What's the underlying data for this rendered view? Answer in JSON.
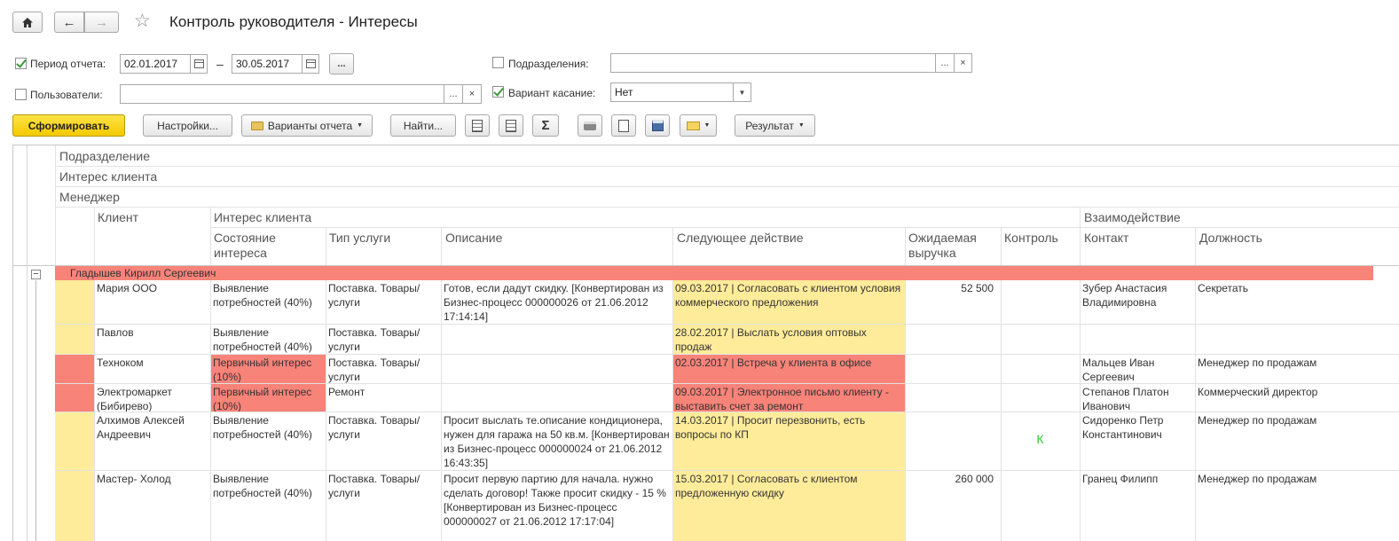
{
  "window": {
    "title": "Контроль руководителя - Интересы"
  },
  "filters": {
    "period_label": "Период отчета:",
    "period_from": "02.01.2017",
    "period_to": "30.05.2017",
    "dash": "–",
    "dots": "...",
    "subdiv_label": "Подразделения:",
    "users_label": "Пользователи:",
    "variant_label": "Вариант касание:",
    "variant_value": "Нет",
    "clear": "×"
  },
  "toolbar": {
    "generate": "Сформировать",
    "settings": "Настройки...",
    "variants": "Варианты отчета",
    "find": "Найти...",
    "sum": "Σ",
    "result": "Результат"
  },
  "report": {
    "group_headers": [
      "Подразделение",
      "Интерес клиента",
      "Менеджер"
    ],
    "col_client": "Клиент",
    "col_interest_group": "Интерес клиента",
    "col_state": "Состояние интереса",
    "col_type": "Тип услуги",
    "col_desc": "Описание",
    "col_next": "Следующее действие",
    "col_revenue": "Ожидаемая выручка",
    "col_control": "Контроль",
    "col_interact_group": "Взаимодействие",
    "col_contact": "Контакт",
    "col_position": "Должность",
    "manager_group": "Гладышев Кирилл Сергеевич",
    "collapse": "−",
    "rows": [
      {
        "client": "Мария ООО",
        "state": "Выявление потребностей (40%)",
        "type": "Поставка. Товары/услуги",
        "desc": "Готов, если дадут скидку. [Конвертирован из Бизнес-процесс 000000026 от 21.06.2012 17:14:14]",
        "next": "09.03.2017 | Согласовать с клиентом условия коммерческого предложения",
        "revenue": "52 500",
        "control": "",
        "contact": "Зубер Анастасия Владимировна",
        "position": "Секретать"
      },
      {
        "client": "Павлов",
        "state": "Выявление потребностей (40%)",
        "type": "Поставка. Товары/услуги",
        "desc": "",
        "next": "28.02.2017 | Выслать условия оптовых продаж",
        "revenue": "",
        "control": "",
        "contact": "",
        "position": ""
      },
      {
        "client": "Техноком",
        "state": "Первичный интерес (10%)",
        "type": "Поставка. Товары/услуги",
        "desc": "",
        "next": "02.03.2017 | Встреча у клиента в офисе",
        "revenue": "",
        "control": "",
        "contact": "Мальцев Иван Сергеевич",
        "position": "Менеджер по продажам"
      },
      {
        "client": "Электромаркет (Бибирево)",
        "state": "Первичный интерес (10%)",
        "type": "Ремонт",
        "desc": "",
        "next": "09.03.2017 | Электронное письмо клиенту - выставить счет за ремонт",
        "revenue": "",
        "control": "",
        "contact": "Степанов Платон Иванович",
        "position": "Коммерческий директор"
      },
      {
        "client": "Алхимов Алексей Андреевич",
        "state": "Выявление потребностей (40%)",
        "type": "Поставка. Товары/услуги",
        "desc": "Просит выслать те.описание кондиционера, нужен для гаража на 50 кв.м. [Конвертирован из Бизнес-процесс 000000024 от 21.06.2012 16:43:35]",
        "next": "14.03.2017 | Просит перезвонить, есть вопросы по КП",
        "revenue": "",
        "control": "К",
        "contact": "Сидоренко Петр Константинович",
        "position": "Менеджер по продажам"
      },
      {
        "client": "Мастер- Холод",
        "state": "Выявление потребностей (40%)",
        "type": "Поставка. Товары/услуги",
        "desc": "Просит первую партию для начала. нужно сделать договор! Также просит скидку - 15 % [Конвертирован из Бизнес-процесс 000000027 от 21.06.2012 17:17:04]",
        "next": "15.03.2017 | Согласовать с клиентом предложенную скидку",
        "revenue": "260 000",
        "control": "",
        "contact": "Гранец Филипп",
        "position": "Менеджер по продажам"
      }
    ]
  }
}
